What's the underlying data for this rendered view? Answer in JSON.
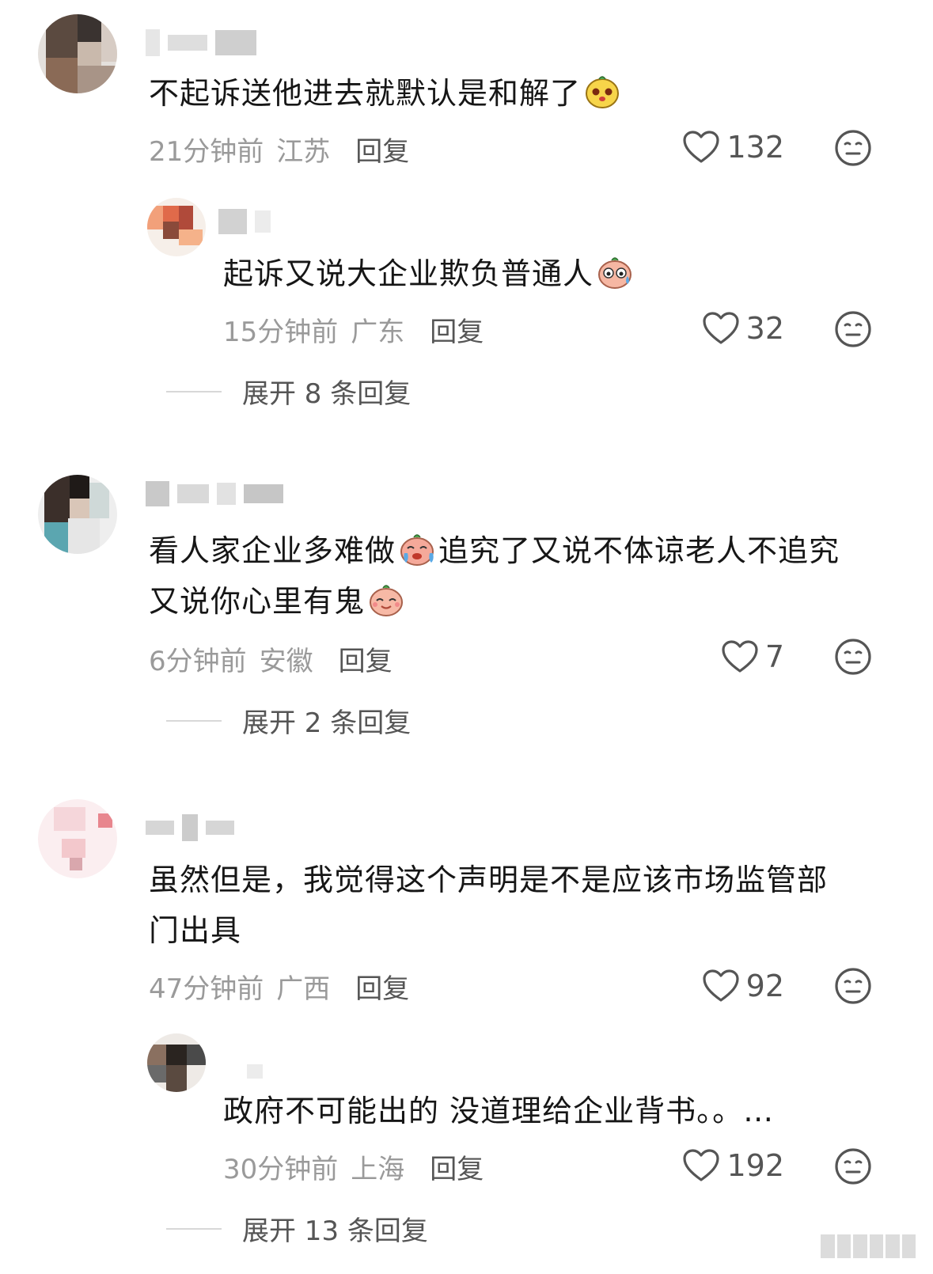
{
  "comments": [
    {
      "text": "不起诉送他进去就默认是和解了",
      "time": "21分钟前",
      "location": "江苏",
      "reply_label": "回复",
      "likes": "132",
      "emoji_icon": "yellow-face-emoji",
      "replies": [
        {
          "text": "起诉又说大企业欺负普通人",
          "time": "15分钟前",
          "location": "广东",
          "reply_label": "回复",
          "likes": "32",
          "emoji_icon": "sweat-face-emoji"
        }
      ],
      "expand_label": "展开 8 条回复"
    },
    {
      "text_line1_a": "看人家企业多难做",
      "text_line1_b": "追究了又说不体谅老人不追究",
      "text_line2": "又说你心里有鬼",
      "time": "6分钟前",
      "location": "安徽",
      "reply_label": "回复",
      "likes": "7",
      "emoji_icons": [
        "crying-face-emoji",
        "smiling-face-emoji"
      ],
      "expand_label": "展开 2 条回复"
    },
    {
      "text_line1": "虽然但是，我觉得这个声明是不是应该市场监管部",
      "text_line2": "门出具",
      "time": "47分钟前",
      "location": "广西",
      "reply_label": "回复",
      "likes": "92",
      "replies": [
        {
          "text": "政府不可能出的 没道理给企业背书。。…",
          "time": "30分钟前",
          "location": "上海",
          "reply_label": "回复",
          "likes": "192"
        }
      ],
      "expand_label": "展开 13 条回复"
    }
  ],
  "icons": {
    "like": "heart-outline-icon",
    "dislike": "meh-face-icon"
  },
  "colors": {
    "text": "#161616",
    "meta": "#9a9a9a",
    "action": "#555555",
    "divider": "#d8d8d8"
  }
}
